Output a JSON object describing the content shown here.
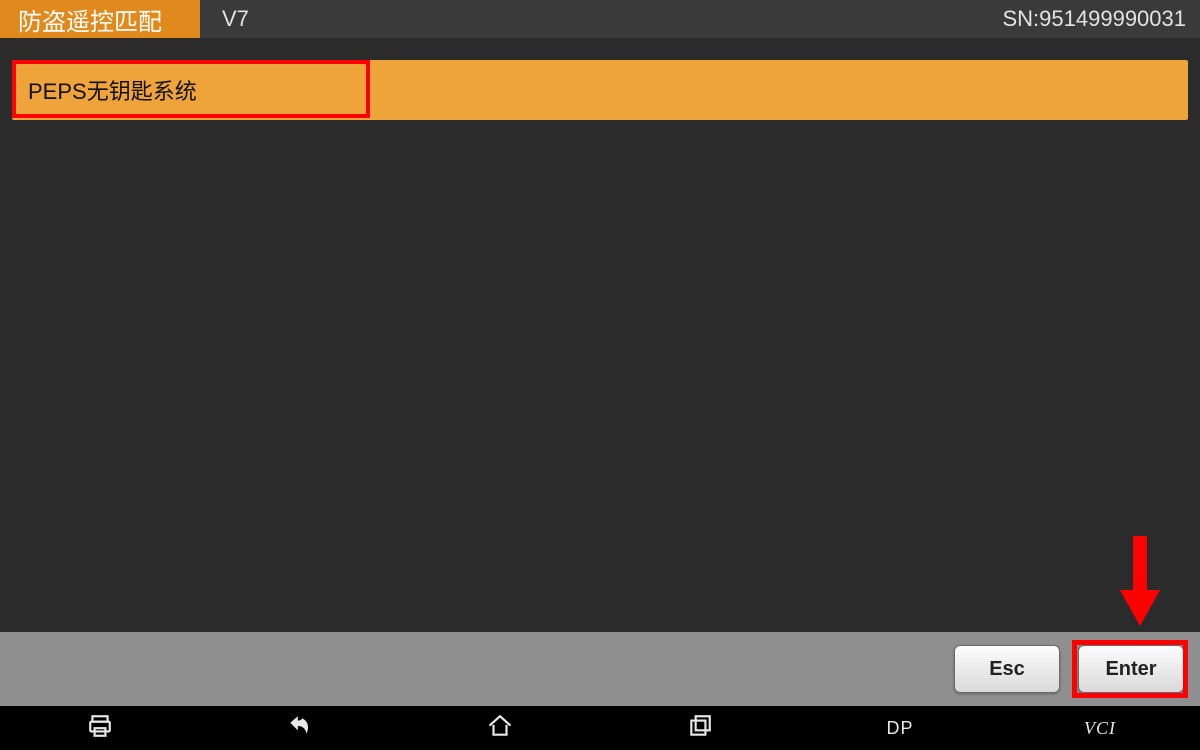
{
  "header": {
    "title": "防盗遥控匹配",
    "version": "V7",
    "sn": "SN:951499990031"
  },
  "list": {
    "items": [
      {
        "label": "PEPS无钥匙系统"
      }
    ]
  },
  "footer": {
    "esc_label": "Esc",
    "enter_label": "Enter"
  },
  "nav": {
    "dp_label": "DP",
    "vci_label": "VCI"
  }
}
